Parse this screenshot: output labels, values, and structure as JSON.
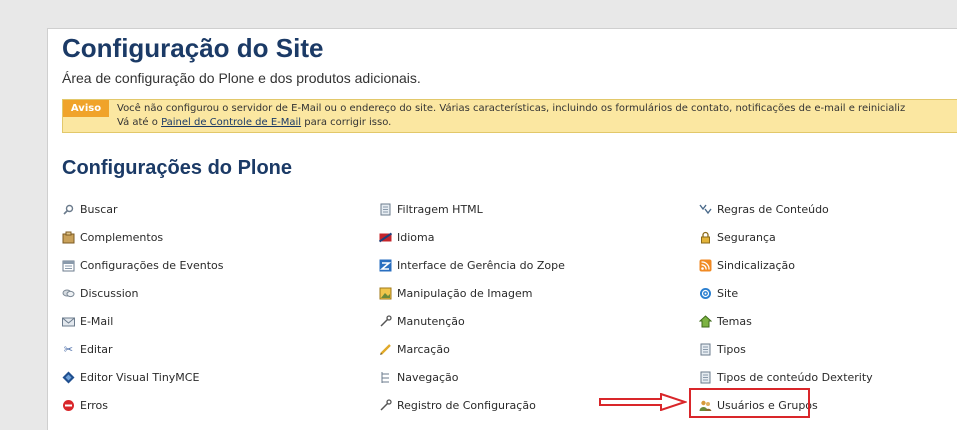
{
  "header": {
    "title": "Configuração do Site",
    "subtitle": "Área de configuração do Plone e dos produtos adicionais."
  },
  "notice": {
    "label": "Aviso",
    "line1": "Você não configurou o servidor de E-Mail ou o endereço do site. Várias características, incluindo os formulários de contato, notificações de e-mail e reinicializ",
    "line2_prefix": "Vá até o ",
    "line2_link": "Painel de Controle de E-Mail",
    "line2_suffix": " para corrigir isso."
  },
  "section": {
    "title": "Configurações do Plone"
  },
  "columns": [
    [
      {
        "label": "Buscar",
        "icon": "search-icon"
      },
      {
        "label": "Complementos",
        "icon": "addons-icon"
      },
      {
        "label": "Configurações de Eventos",
        "icon": "calendar-icon"
      },
      {
        "label": "Discussion",
        "icon": "discussion-icon"
      },
      {
        "label": "E-Mail",
        "icon": "mail-icon"
      },
      {
        "label": "Editar",
        "icon": "scissors-icon"
      },
      {
        "label": "Editor Visual TinyMCE",
        "icon": "tinymce-icon"
      },
      {
        "label": "Erros",
        "icon": "error-icon"
      }
    ],
    [
      {
        "label": "Filtragem HTML",
        "icon": "document-icon"
      },
      {
        "label": "Idioma",
        "icon": "flag-icon"
      },
      {
        "label": "Interface de Gerência do Zope",
        "icon": "zope-icon"
      },
      {
        "label": "Manipulação de Imagem",
        "icon": "image-icon"
      },
      {
        "label": "Manutenção",
        "icon": "wrench-icon"
      },
      {
        "label": "Marcação",
        "icon": "pencil-icon"
      },
      {
        "label": "Navegação",
        "icon": "navigation-icon"
      },
      {
        "label": "Registro de Configuração",
        "icon": "wrench-icon"
      }
    ],
    [
      {
        "label": "Regras de Conteúdo",
        "icon": "rules-icon"
      },
      {
        "label": "Segurança",
        "icon": "lock-icon"
      },
      {
        "label": "Sindicalização",
        "icon": "rss-icon"
      },
      {
        "label": "Site",
        "icon": "site-icon"
      },
      {
        "label": "Temas",
        "icon": "themes-icon"
      },
      {
        "label": "Tipos",
        "icon": "document-icon"
      },
      {
        "label": "Tipos de conteúdo Dexterity",
        "icon": "document-icon"
      },
      {
        "label": "Usuários e Grupos",
        "icon": "users-icon"
      }
    ]
  ],
  "colors": {
    "title": "#1b3a66",
    "notice_bg": "#fbe7a1",
    "notice_label_bg": "#f0a32a",
    "highlight": "#d9262a"
  }
}
